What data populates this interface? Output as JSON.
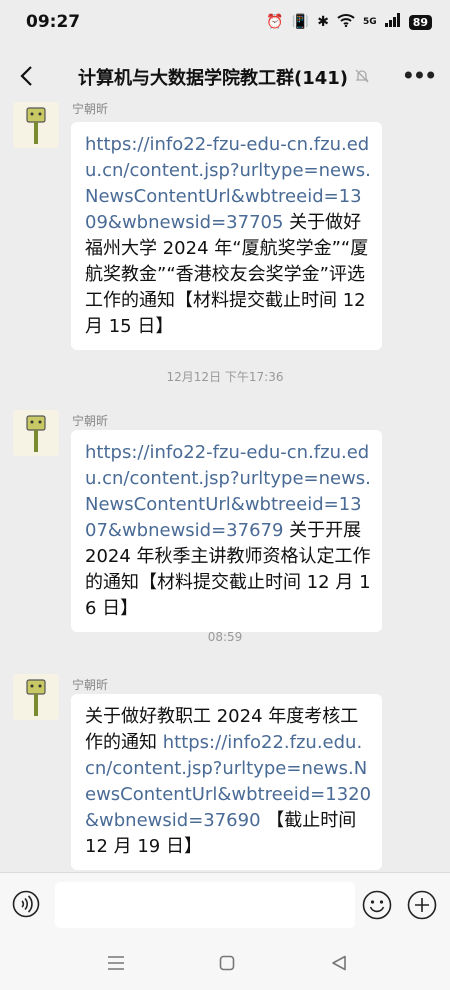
{
  "status": {
    "time": "09:27",
    "signal": "5G",
    "battery": "89"
  },
  "header": {
    "title": "计算机与大数据学院教工群(141)"
  },
  "messages": [
    {
      "sender": "宁朝昕",
      "link": "https://info22-fzu-edu-cn.fzu.edu.cn/content.jsp?urltype=news.NewsContentUrl&wbtreeid=1309&wbnewsid=37705",
      "text": " 关于做好福州大学 2024 年“厦航奖学金”“厦航奖教金”“香港校友会奖学金”评选工作的通知【材料提交截止时间 12 月 15 日】"
    },
    {
      "timestamp": "12月12日 下午17:36",
      "sender": "宁朝昕",
      "link": "https://info22-fzu-edu-cn.fzu.edu.cn/content.jsp?urltype=news.NewsContentUrl&wbtreeid=1307&wbnewsid=37679",
      "text": " 关于开展 2024 年秋季主讲教师资格认定工作的通知【材料提交截止时间 12 月 16 日】"
    },
    {
      "timestamp": "08:59",
      "sender": "宁朝昕",
      "prefix": "关于做好教职工 2024 年度考核工作的通知 ",
      "link": "https://info22.fzu.edu.cn/content.jsp?urltype=news.NewsContentUrl&wbtreeid=1320&wbnewsid=37690",
      "text": " 【截止时间 12 月 19 日】"
    }
  ],
  "colors": {
    "background": "#ededed",
    "bubble": "#ffffff",
    "link": "#4a6b96"
  }
}
